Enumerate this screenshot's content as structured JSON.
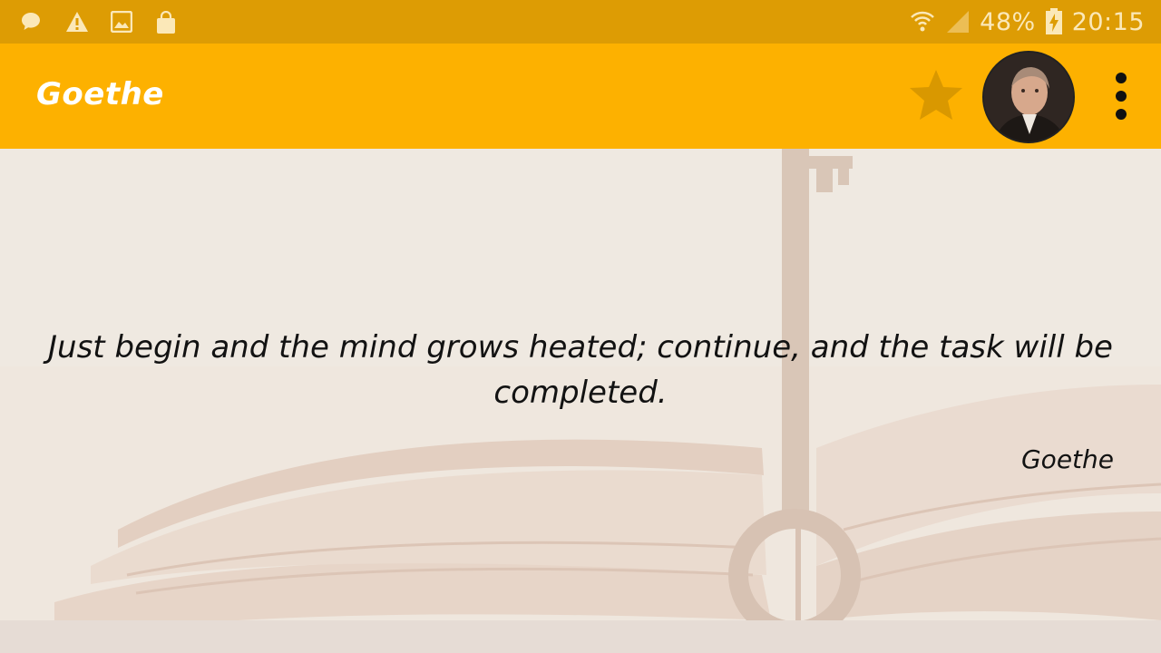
{
  "status_bar": {
    "icons_left": [
      "chat-bubble-icon",
      "warning-icon",
      "image-icon",
      "shopping-bag-icon"
    ],
    "battery_percent": "48%",
    "time": "20:15",
    "icons_right": [
      "wifi-icon",
      "signal-icon",
      "battery-charging-icon"
    ]
  },
  "app_bar": {
    "title": "Goethe",
    "favorite_icon": "star-icon",
    "avatar_icon": "author-portrait",
    "menu_icon": "more-vert-icon"
  },
  "quote": {
    "text": "Just begin and the mind grows heated; continue, and the task will be completed.",
    "author": "Goethe"
  },
  "colors": {
    "status_bar": "#dd9c04",
    "app_bar": "#fdb100",
    "star": "#d99800",
    "text": "#121212"
  }
}
